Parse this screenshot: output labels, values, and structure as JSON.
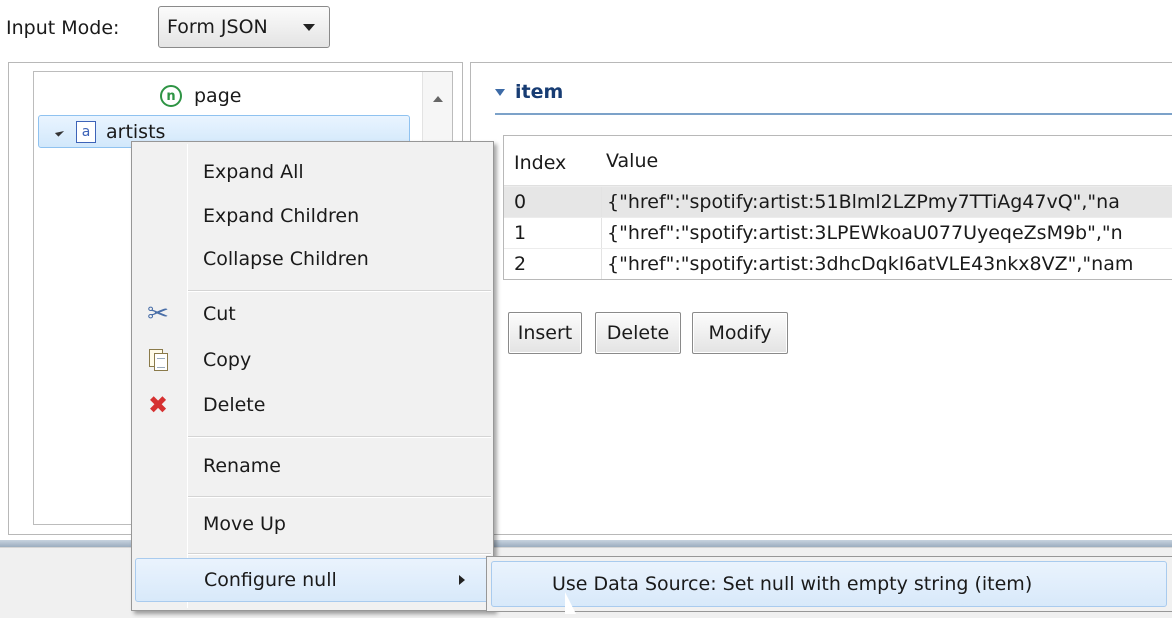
{
  "input_mode": {
    "label": "Input Mode:",
    "selected": "Form JSON"
  },
  "tree": {
    "nodes": [
      {
        "label": "page",
        "badge": "n"
      },
      {
        "label": "artists",
        "badge": "a"
      }
    ]
  },
  "detail": {
    "section_title": "item",
    "columns": [
      "Index",
      "Value"
    ],
    "rows": [
      {
        "index": "0",
        "value": "{\"href\":\"spotify:artist:51Blml2LZPmy7TTiAg47vQ\",\"na"
      },
      {
        "index": "1",
        "value": "{\"href\":\"spotify:artist:3LPEWkoaU077UyeqeZsM9b\",\"n"
      },
      {
        "index": "2",
        "value": "{\"href\":\"spotify:artist:3dhcDqkI6atVLE43nkx8VZ\",\"nam"
      }
    ],
    "buttons": {
      "insert": "Insert",
      "delete": "Delete",
      "modify": "Modify"
    }
  },
  "context_menu": {
    "items": [
      {
        "label": "Expand All"
      },
      {
        "label": "Expand Children"
      },
      {
        "label": "Collapse Children"
      },
      {
        "label": "Cut",
        "icon": "scissors-icon"
      },
      {
        "label": "Copy",
        "icon": "copy-icon"
      },
      {
        "label": "Delete",
        "icon": "delete-icon"
      },
      {
        "label": "Rename"
      },
      {
        "label": "Move Up"
      },
      {
        "label": "Configure null",
        "submenu": true
      }
    ]
  },
  "submenu": {
    "items": [
      {
        "label": "Use Data Source: Set null with empty string (item)"
      }
    ]
  }
}
